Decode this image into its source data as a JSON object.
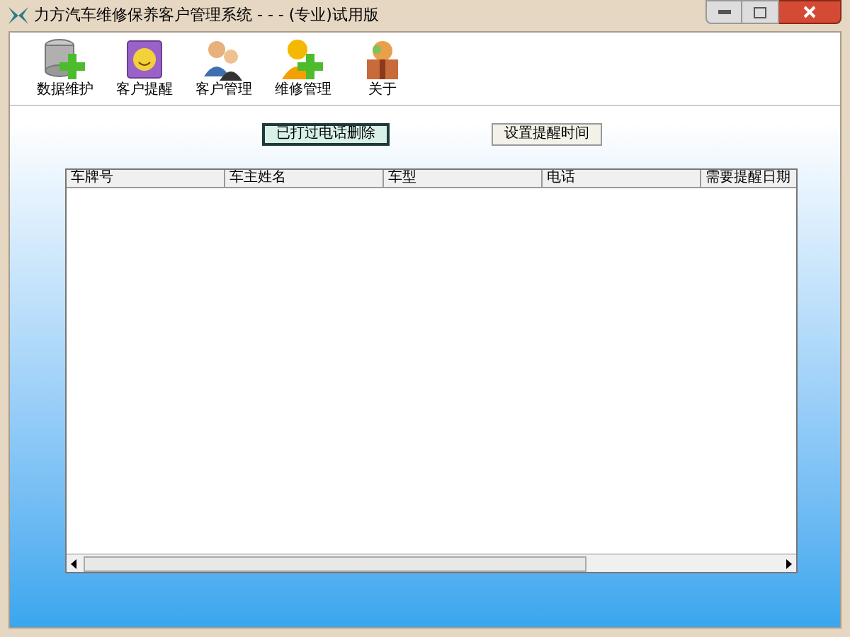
{
  "window": {
    "title": "力方汽车维修保养客户管理系统 - - - (专业)试用版"
  },
  "toolbar": [
    {
      "label": "数据维护",
      "kind": "database"
    },
    {
      "label": "客户提醒",
      "kind": "reminder"
    },
    {
      "label": "客户管理",
      "kind": "customers"
    },
    {
      "label": "维修管理",
      "kind": "repair"
    },
    {
      "label": "关于",
      "kind": "about"
    }
  ],
  "actions": [
    {
      "label": "已打过电话删除",
      "focused": true
    },
    {
      "label": "设置提醒时间",
      "focused": false
    }
  ],
  "table": {
    "columns": [
      "车牌号",
      "车主姓名",
      "车型",
      "电话",
      "需要提醒日期"
    ]
  }
}
